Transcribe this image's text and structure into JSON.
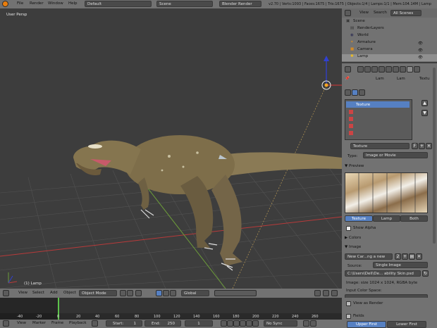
{
  "colors": {
    "viewport_bg": "#3d3d3d",
    "header_bg": "#727272",
    "panel_bg": "#727272",
    "accent_blue": "#5680c2",
    "axis_red": "#b83a3a",
    "axis_green": "#6c9c3a",
    "axis_blue": "#3040d0",
    "timeline_bg": "#2a2a2a",
    "current_frame": "#5cc34a"
  },
  "info_header": {
    "menu": [
      "File",
      "Render",
      "Window",
      "Help"
    ],
    "layout": "Default",
    "scene": "Scene",
    "engine": "Blender Render",
    "stats": "v2.70 | Verts:1093 | Faces:1675 | Tris:1675 | Objects:1/4 | Lamps:1/1 | Mem:104.14M | Lamp"
  },
  "viewport": {
    "view_label": "User Persp",
    "object_label": "(1) Lamp"
  },
  "view3d_header": {
    "menu": [
      "View",
      "Select",
      "Add",
      "Object"
    ],
    "mode": "Object Mode",
    "orientation": "Global"
  },
  "outliner": {
    "view": "View",
    "search": "Search",
    "filter": "All Scenes",
    "items": [
      "Scene",
      "RenderLayers",
      "World",
      "Armature",
      "Camera",
      "Lamp"
    ]
  },
  "properties": {
    "breadcrumb": [
      "Lam",
      "Lam",
      "Textu"
    ],
    "texture_slots": [
      "Texture"
    ],
    "texture_name": "Texture",
    "type_label": "Type:",
    "type_value": "Image or Movie",
    "preview_label": "Preview",
    "preview_tabs": [
      "Texture",
      "Lamp",
      "Both"
    ],
    "show_alpha": "Show Alpha",
    "colors_label": "Colors",
    "image_label": "Image",
    "image_name": "New Car...ng a new",
    "source_label": "Source:",
    "source_value": "Single Image",
    "filepath": "C:\\Users\\Dell\\De... ability Skin.psd",
    "image_info": "Image: size 1024 x 1024, RGBA byte",
    "input_color_space": "Input Color Space:",
    "view_as_render": "View as Render",
    "fields": "Fields",
    "fields_tabs": [
      "Upper First",
      "Lower First"
    ]
  },
  "timeline": {
    "ticks": [
      "-40",
      "-20",
      "0",
      "20",
      "40",
      "60",
      "80",
      "100",
      "120",
      "140",
      "160",
      "180",
      "200",
      "220",
      "240",
      "260"
    ],
    "menu": [
      "View",
      "Marker",
      "Frame",
      "Playback"
    ],
    "start_label": "Start:",
    "start": "1",
    "end_label": "End:",
    "end": "250",
    "current": "1",
    "sync": "No Sync"
  }
}
